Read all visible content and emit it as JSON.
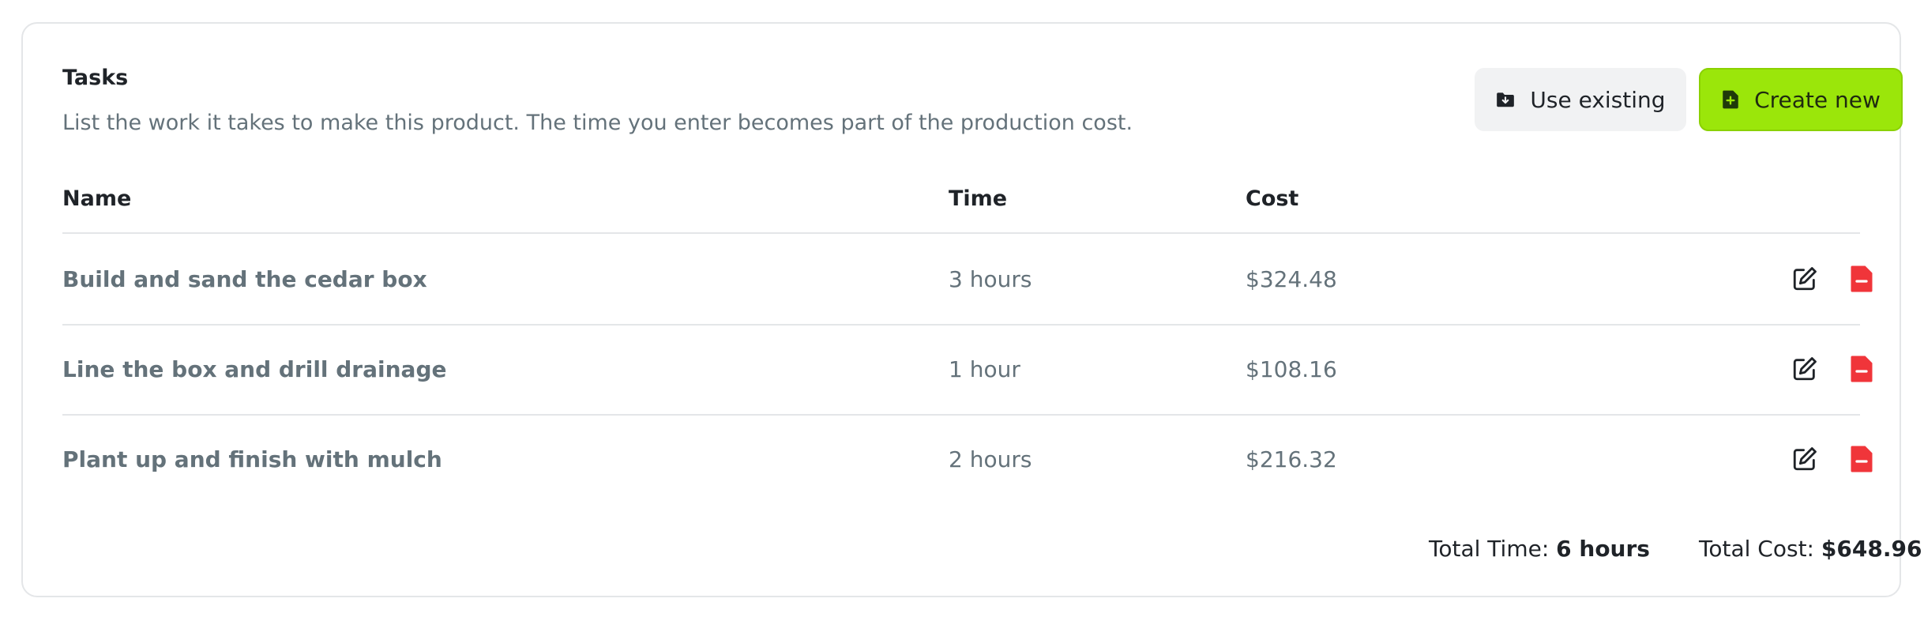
{
  "header": {
    "title": "Tasks",
    "description": "List the work it takes to make this product. The time you enter becomes part of the production cost."
  },
  "actions": {
    "use_existing_label": "Use existing",
    "use_existing_icon": "folder-download-icon",
    "create_new_label": "Create new",
    "create_new_icon": "file-plus-icon"
  },
  "table": {
    "columns": [
      "Name",
      "Time",
      "Cost"
    ],
    "rows": [
      {
        "name": "Build and sand the cedar box",
        "time": "3 hours",
        "cost": "$324.48"
      },
      {
        "name": "Line the box and drill drainage",
        "time": "1 hour",
        "cost": "$108.16"
      },
      {
        "name": "Plant up and finish with mulch",
        "time": "2 hours",
        "cost": "$216.32"
      }
    ],
    "row_actions": [
      "edit-icon",
      "delete-file-icon"
    ]
  },
  "totals": {
    "time_label": "Total Time:",
    "time_value": "6 hours",
    "cost_label": "Total Cost:",
    "cost_value": "$648.96"
  },
  "colors": {
    "accent": "#9be60a",
    "danger": "#f0353a",
    "muted_text": "#64727a",
    "border": "#e4e6e8"
  }
}
